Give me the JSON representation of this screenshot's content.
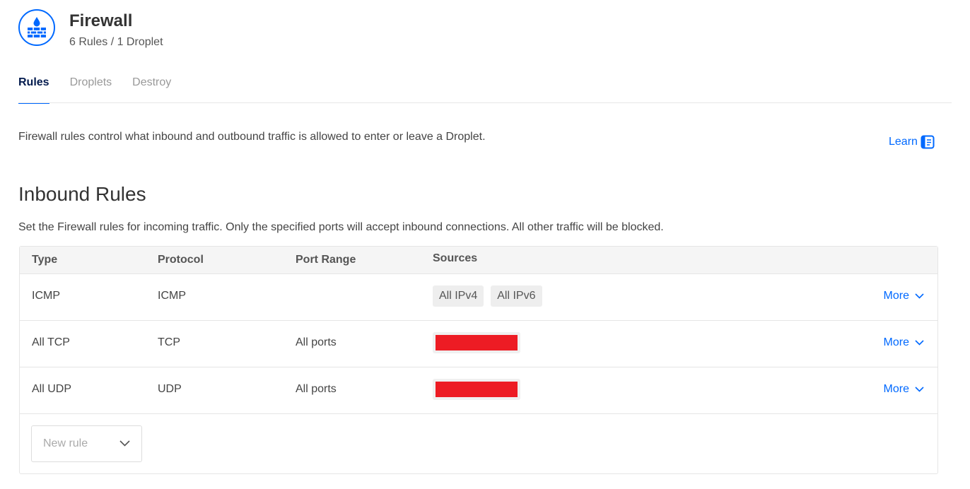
{
  "header": {
    "icon": "firewall-icon",
    "title": "Firewall",
    "subtitle": "6 Rules / 1 Droplet"
  },
  "tabs": [
    {
      "label": "Rules",
      "active": true
    },
    {
      "label": "Droplets",
      "active": false
    },
    {
      "label": "Destroy",
      "active": false
    }
  ],
  "intro": {
    "text": "Firewall rules control what inbound and outbound traffic is allowed to enter or leave a Droplet.",
    "learn_label": "Learn",
    "learn_icon": "doc-icon"
  },
  "inbound": {
    "title": "Inbound Rules",
    "description": "Set the Firewall rules for incoming traffic. Only the specified ports will accept inbound connections. All other traffic will be blocked.",
    "columns": [
      "Type",
      "Protocol",
      "Port Range",
      "Sources"
    ],
    "rows": [
      {
        "type": "ICMP",
        "protocol": "ICMP",
        "port_range": "",
        "sources": [
          "All IPv4",
          "All IPv6"
        ],
        "more": "More"
      },
      {
        "type": "All TCP",
        "protocol": "TCP",
        "port_range": "All ports",
        "sources": [],
        "more": "More"
      },
      {
        "type": "All UDP",
        "protocol": "UDP",
        "port_range": "All ports",
        "sources": [],
        "more": "More"
      }
    ],
    "new_rule_placeholder": "New rule"
  },
  "colors": {
    "accent": "#0069ff",
    "redaction": "#ed1c24"
  }
}
